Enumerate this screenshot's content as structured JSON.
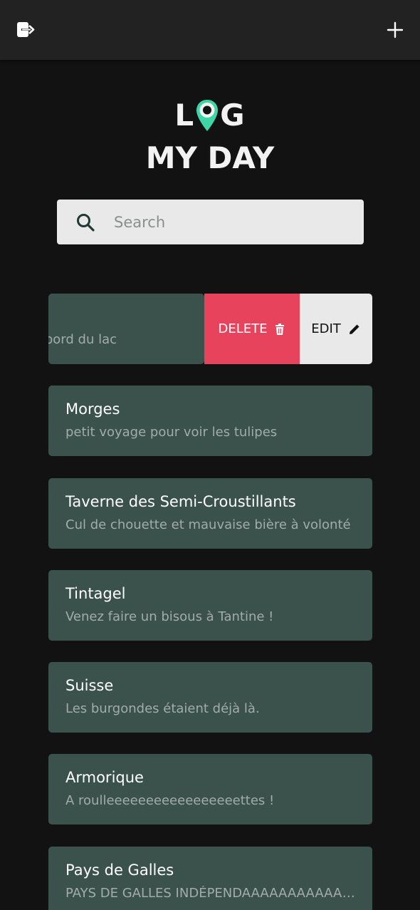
{
  "header": {
    "logout_icon": "logout-icon",
    "add_icon": "plus-icon"
  },
  "logo": {
    "line1_left": "L",
    "line1_right": "G",
    "line2": "MY DAY",
    "pin_color": "#3ed6a6"
  },
  "search": {
    "placeholder": "Search",
    "value": ""
  },
  "swiped_entry": {
    "subtitle_visible": "bord du lac",
    "delete_label": "DELETE",
    "edit_label": "EDIT",
    "delete_color": "#e8435c"
  },
  "entries": [
    {
      "title": "Morges",
      "subtitle": "petit voyage pour voir les tulipes"
    },
    {
      "title": "Taverne des Semi-Croustillants",
      "subtitle": "Cul de chouette et mauvaise bière à volonté"
    },
    {
      "title": "Tintagel",
      "subtitle": "Venez faire un bisous à Tantine !"
    },
    {
      "title": "Suisse",
      "subtitle": "Les burgondes étaient déjà là."
    },
    {
      "title": "Armorique",
      "subtitle": "A roulleeeeeeeeeeeeeeeeettes !"
    },
    {
      "title": "Pays de Galles",
      "subtitle": "PAYS DE GALLES INDÉPENDAAAAAAAAAAAAANT"
    }
  ]
}
